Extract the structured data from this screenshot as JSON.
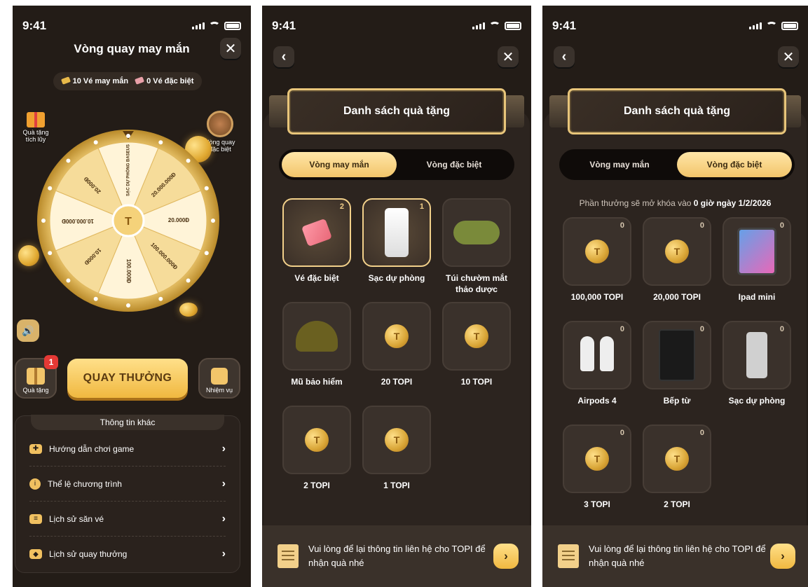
{
  "status": {
    "time": "9:41"
  },
  "screen1": {
    "title": "Vòng quay may mắn",
    "tickets": {
      "lucky": "10 Vé may mắn",
      "special": "0 Vé đặc biệt"
    },
    "left_label": "Quà tặng tích lũy",
    "right_label": "Vòng quay đặc biệt",
    "wheel_segments": [
      "SẠC DỰ PHÒNG BASEUS",
      "20.000.000Đ",
      "20.000Đ",
      "100.000.000Đ",
      "100.000Đ",
      "10.000Đ",
      "10.000.000Đ",
      "20.000Đ"
    ],
    "gifts_label": "Quà tặng",
    "gifts_badge": "1",
    "spin_label": "QUAY THƯỞNG",
    "missions_label": "Nhiệm vụ",
    "info_title": "Thông tin khác",
    "info_items": [
      {
        "label": "Hướng dẫn chơi game",
        "icon": "gamepad-icon"
      },
      {
        "label": "Thể lệ chương trình",
        "icon": "info-icon"
      },
      {
        "label": "Lịch sử săn vé",
        "icon": "ticket-history-icon"
      },
      {
        "label": "Lịch sử quay thưởng",
        "icon": "gift-history-icon"
      }
    ]
  },
  "screen2": {
    "banner": "Danh sách quà tặng",
    "tabs": [
      "Vòng may mắn",
      "Vòng đặc biệt"
    ],
    "active_tab": 0,
    "items": [
      {
        "label": "Vé đặc biệt",
        "qty": "2",
        "img": "tickets",
        "selected": true
      },
      {
        "label": "Sạc dự phòng",
        "qty": "1",
        "img": "powerbank",
        "selected": true
      },
      {
        "label": "Túi chườm mắt thảo dược",
        "qty": "",
        "img": "eyebag",
        "selected": false
      },
      {
        "label": "Mũ bảo hiểm",
        "qty": "",
        "img": "helmet",
        "selected": false
      },
      {
        "label": "20 TOPI",
        "qty": "",
        "img": "coin",
        "selected": false
      },
      {
        "label": "10 TOPI",
        "qty": "",
        "img": "coin",
        "selected": false
      },
      {
        "label": "2 TOPI",
        "qty": "",
        "img": "coin",
        "selected": false
      },
      {
        "label": "1 TOPI",
        "qty": "",
        "img": "coin",
        "selected": false
      }
    ],
    "bottom_text": "Vui lòng để lại thông tin liên hệ cho TOPI để nhận quà nhé"
  },
  "screen3": {
    "banner": "Danh sách quà tặng",
    "tabs": [
      "Vòng may mắn",
      "Vòng đặc biệt"
    ],
    "active_tab": 1,
    "notice_prefix": "Phần thưởng sẽ mở khóa vào ",
    "notice_bold": "0 giờ ngày 1/2/2026",
    "items": [
      {
        "label": "100,000 TOPI",
        "qty": "0",
        "img": "coin"
      },
      {
        "label": "20,000 TOPI",
        "qty": "0",
        "img": "coin"
      },
      {
        "label": "Ipad mini",
        "qty": "0",
        "img": "ipad"
      },
      {
        "label": "Airpods 4",
        "qty": "0",
        "img": "airpods"
      },
      {
        "label": "Bếp từ",
        "qty": "0",
        "img": "cooktop"
      },
      {
        "label": "Sạc dự phòng",
        "qty": "0",
        "img": "pbank"
      },
      {
        "label": "3 TOPI",
        "qty": "0",
        "img": "coin"
      },
      {
        "label": "2 TOPI",
        "qty": "0",
        "img": "coin"
      }
    ],
    "bottom_text": "Vui lòng để lại thông tin liên hệ cho TOPI để nhận quà nhé"
  }
}
